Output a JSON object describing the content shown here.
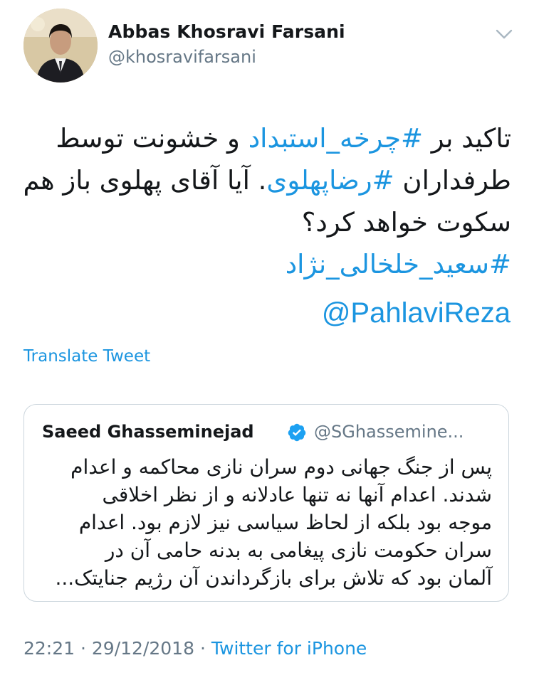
{
  "tweet": {
    "author_name": "Abbas Khosravi Farsani",
    "author_handle": "@khosravifarsani",
    "body": {
      "line1": {
        "pre": "تاکید بر ",
        "tag": "#چرخه_استبداد",
        "post": " و خشونت توسط"
      },
      "line2": {
        "pre": "طرفداران ",
        "tag": "#رضاپهلوی",
        "post": ". آیا آقای پهلوی باز هم"
      },
      "line3": "سکوت خواهد کرد؟",
      "line4_tag": "#سعید_خلخالی_نژاد",
      "mention": "@PahlaviReza"
    },
    "translate_label": "Translate Tweet",
    "time": "22:21",
    "separator": "·",
    "date": "29/12/2018",
    "source": "Twitter for iPhone"
  },
  "quoted_tweet": {
    "author_name": "Saeed Ghasseminejad",
    "author_handle": "@SGhassemine...",
    "verified": true,
    "lines": [
      "پس از جنگ جهانی دوم سران نازی محاکمه و اعدام",
      "شدند. اعدام آنها نه تنها عادلانه و از نظر اخلاقی",
      "موجه بود بلکه از لحاظ سیاسی نیز لازم بود. اعدام",
      "سران حکومت نازی پیغامی به بدنه حامی آن در",
      "آلمان بود که تلاش برای بازگرداندن آن رژیم جنایتک..."
    ]
  },
  "icons": {
    "avatar": "profile-photo",
    "menu": "chevron-down-icon",
    "verified": "verified-badge-icon"
  },
  "colors": {
    "link": "#1b95e0",
    "secondary_text": "#657786",
    "primary_text": "#14171a",
    "border": "#ccd6dd"
  }
}
